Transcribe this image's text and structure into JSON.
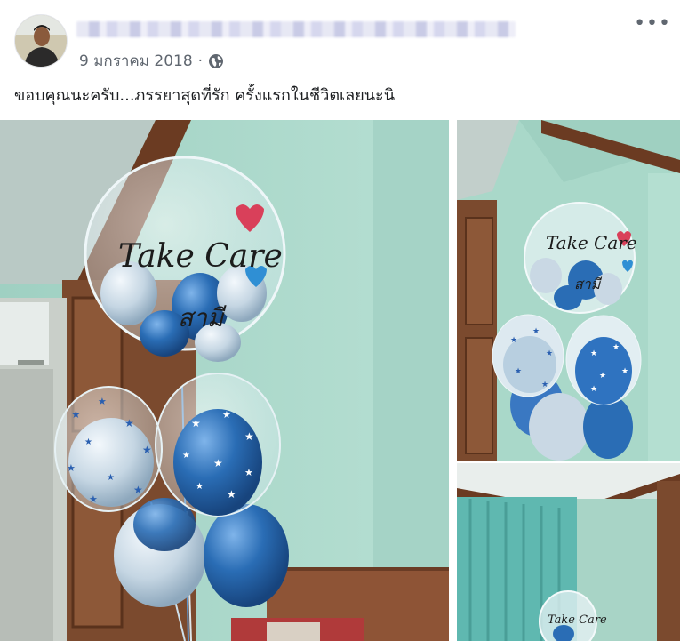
{
  "post": {
    "author_name": "",
    "date": "9 มกราคม 2018",
    "separator": "·",
    "privacy_icon": "globe-icon",
    "more_icon": "more-options-icon",
    "more_label": "•••",
    "caption": "ขอบคุณนะครับ...ภรรยาสุดที่รัก ครั้งแรกในชีวิตเลยนะนิ"
  },
  "photos": {
    "main": {
      "balloon_text_line1": "Take Care",
      "balloon_text_line2": "สามี"
    },
    "top_right": {
      "balloon_text_line1": "Take Care",
      "balloon_text_line2": "สามี"
    },
    "bottom_right": {
      "balloon_text_line1": "Take Care"
    }
  },
  "colors": {
    "wall": "#a9d6c8",
    "wood": "#6b3b22",
    "balloon_blue": "#2a6db5",
    "balloon_silver": "#c9d8e4",
    "heart_red": "#d9405a",
    "heart_blue": "#2f8fd4",
    "curtain": "#5fb8b0"
  }
}
